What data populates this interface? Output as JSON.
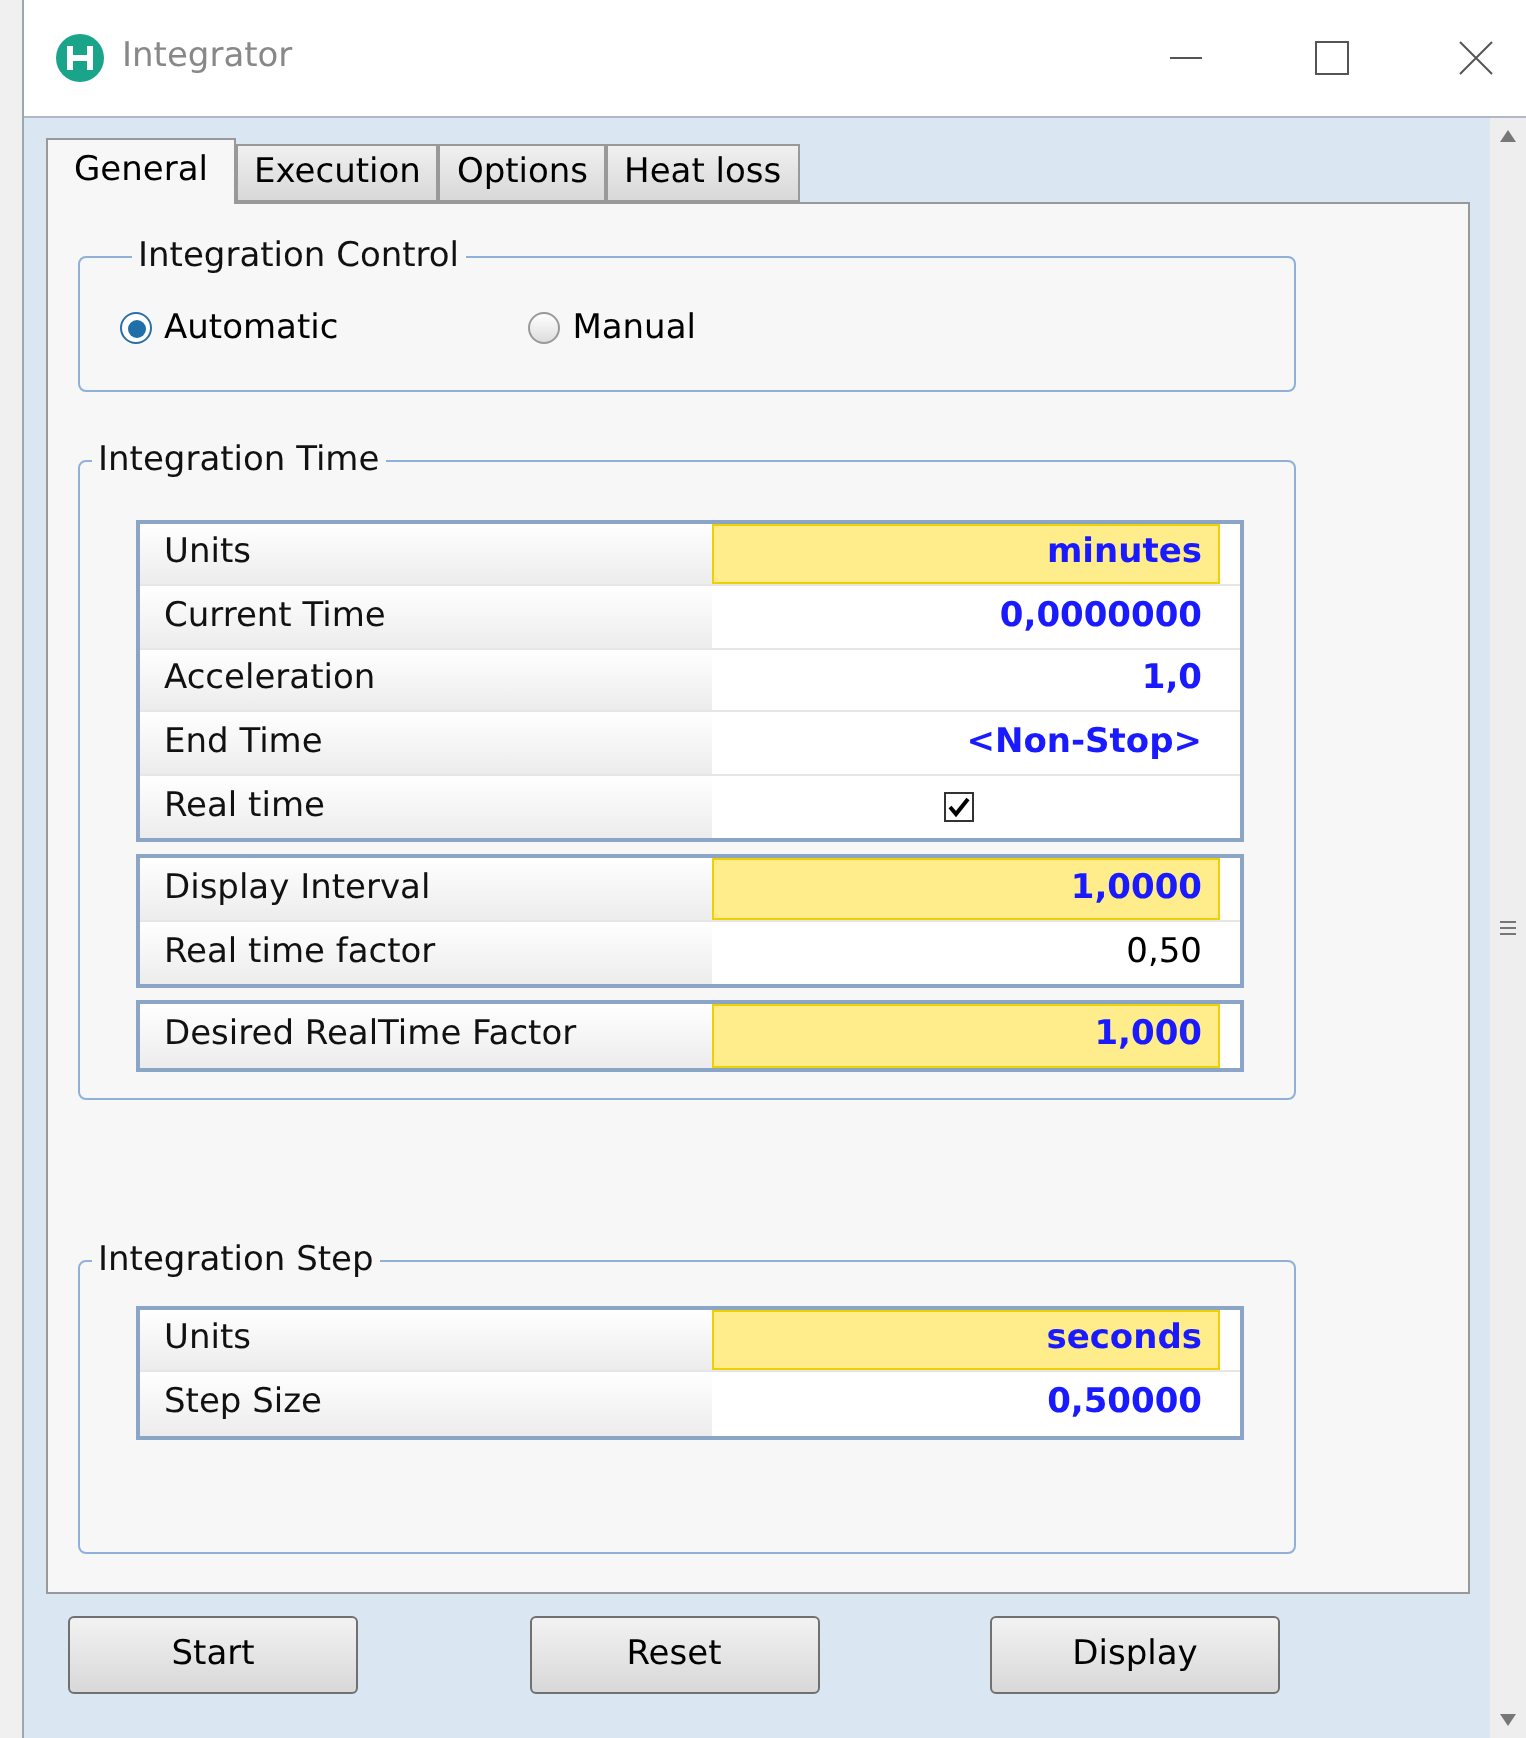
{
  "window": {
    "title": "Integrator"
  },
  "tabs": [
    {
      "label": "General",
      "selected": true
    },
    {
      "label": "Execution",
      "selected": false
    },
    {
      "label": "Options",
      "selected": false
    },
    {
      "label": "Heat loss",
      "selected": false
    }
  ],
  "integration_control": {
    "title": "Integration Control",
    "options": [
      {
        "label": "Automatic",
        "selected": true
      },
      {
        "label": "Manual",
        "selected": false
      }
    ]
  },
  "integration_time": {
    "title": "Integration Time",
    "grids": [
      [
        {
          "label": "Units",
          "kind": "value",
          "value": "minutes",
          "highlighted": true
        },
        {
          "label": "Current Time",
          "kind": "value",
          "value": "0,0000000",
          "highlighted": false
        },
        {
          "label": "Acceleration",
          "kind": "value",
          "value": "1,0",
          "highlighted": false
        },
        {
          "label": "End Time",
          "kind": "value",
          "value": "<Non-Stop>",
          "highlighted": false
        },
        {
          "label": "Real time",
          "kind": "checkbox",
          "checked": true,
          "highlighted": false
        }
      ],
      [
        {
          "label": "Display Interval",
          "kind": "value",
          "value": "1,0000",
          "highlighted": true
        },
        {
          "label": "Real time factor",
          "kind": "readonly",
          "value": "0,50",
          "highlighted": false
        }
      ],
      [
        {
          "label": "Desired RealTime Factor",
          "kind": "value",
          "value": "1,000",
          "highlighted": true
        }
      ]
    ]
  },
  "integration_step": {
    "title": "Integration Step",
    "grids": [
      [
        {
          "label": "Units",
          "kind": "value",
          "value": "seconds",
          "highlighted": true
        },
        {
          "label": "Step Size",
          "kind": "value",
          "value": "0,50000",
          "highlighted": false
        }
      ]
    ]
  },
  "buttons": [
    "Start",
    "Reset",
    "Display"
  ]
}
